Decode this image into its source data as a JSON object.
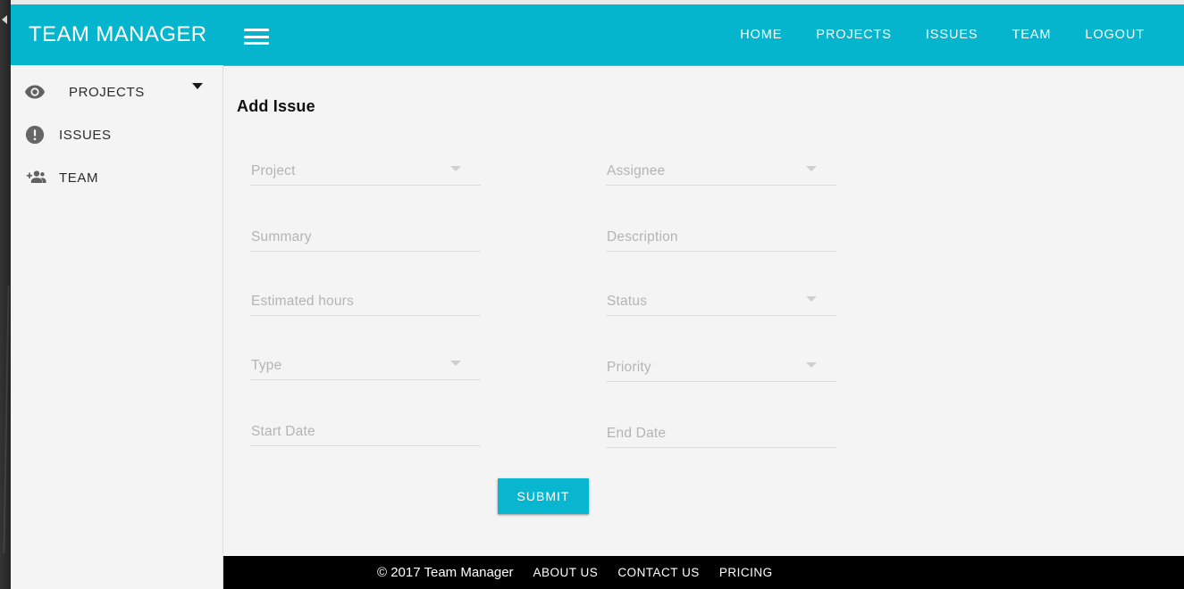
{
  "brand": {
    "title": "TEAM MANAGER"
  },
  "navbar": {
    "menu_icon": "hamburger-icon",
    "links": [
      {
        "label": "HOME"
      },
      {
        "label": "PROJECTS"
      },
      {
        "label": "ISSUES"
      },
      {
        "label": "TEAM"
      },
      {
        "label": "LOGOUT"
      }
    ]
  },
  "sidebar": {
    "items": [
      {
        "label": "PROJECTS",
        "icon": "eye-icon",
        "has_caret": true
      },
      {
        "label": "ISSUES",
        "icon": "error-circle-icon",
        "has_caret": false
      },
      {
        "label": "TEAM",
        "icon": "group-add-icon",
        "has_caret": false
      }
    ]
  },
  "main": {
    "page_title": "Add Issue",
    "form": {
      "left_column": [
        {
          "placeholder": "Project",
          "type": "select"
        },
        {
          "placeholder": "Summary",
          "type": "text"
        },
        {
          "placeholder": "Estimated hours",
          "type": "text"
        },
        {
          "placeholder": "Type",
          "type": "select"
        },
        {
          "placeholder": "Start Date",
          "type": "text"
        }
      ],
      "right_column": [
        {
          "placeholder": "Assignee",
          "type": "select"
        },
        {
          "placeholder": "Description",
          "type": "text"
        },
        {
          "placeholder": "Status",
          "type": "select"
        },
        {
          "placeholder": "Priority",
          "type": "select"
        },
        {
          "placeholder": "End Date",
          "type": "text"
        }
      ],
      "submit_label": "SUBMIT"
    }
  },
  "footer": {
    "copyright": "© 2017 Team Manager",
    "links": [
      {
        "label": "ABOUT US"
      },
      {
        "label": "CONTACT US"
      },
      {
        "label": "PRICING"
      }
    ]
  },
  "colors": {
    "accent": "#05b4cd",
    "footer_bg": "#000000",
    "surface": "#f4f4f4",
    "rail": "#2b2b2b"
  }
}
